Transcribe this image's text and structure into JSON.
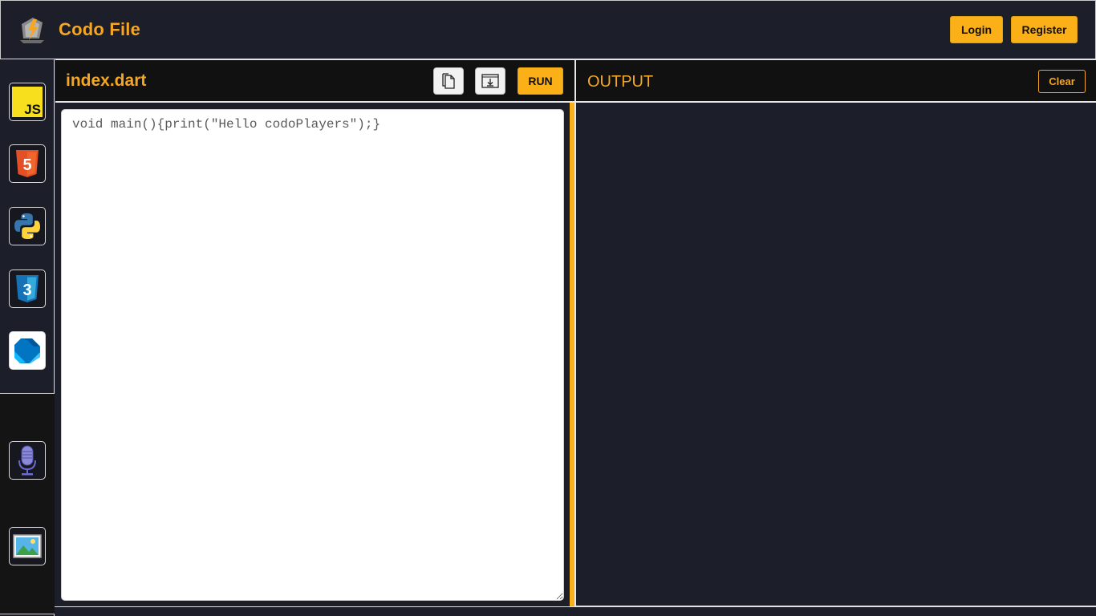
{
  "header": {
    "brand_name": "Codo File",
    "login_label": "Login",
    "register_label": "Register"
  },
  "sidebar": {
    "items": [
      {
        "name": "javascript",
        "label": "JS"
      },
      {
        "name": "html5",
        "label": "5"
      },
      {
        "name": "python",
        "label": ""
      },
      {
        "name": "css3",
        "label": "3"
      },
      {
        "name": "dart",
        "label": ""
      },
      {
        "name": "microphone",
        "label": ""
      },
      {
        "name": "image",
        "label": ""
      }
    ],
    "active": "dart"
  },
  "editor": {
    "file_name": "index.dart",
    "run_label": "RUN",
    "code": "void main(){print(\"Hello codoPlayers\");}"
  },
  "output": {
    "title": "OUTPUT",
    "clear_label": "Clear",
    "content": ""
  },
  "colors": {
    "accent": "#fbb018",
    "brand_text": "#f5a623",
    "background": "#1c1e29",
    "panel_header": "#111111"
  }
}
